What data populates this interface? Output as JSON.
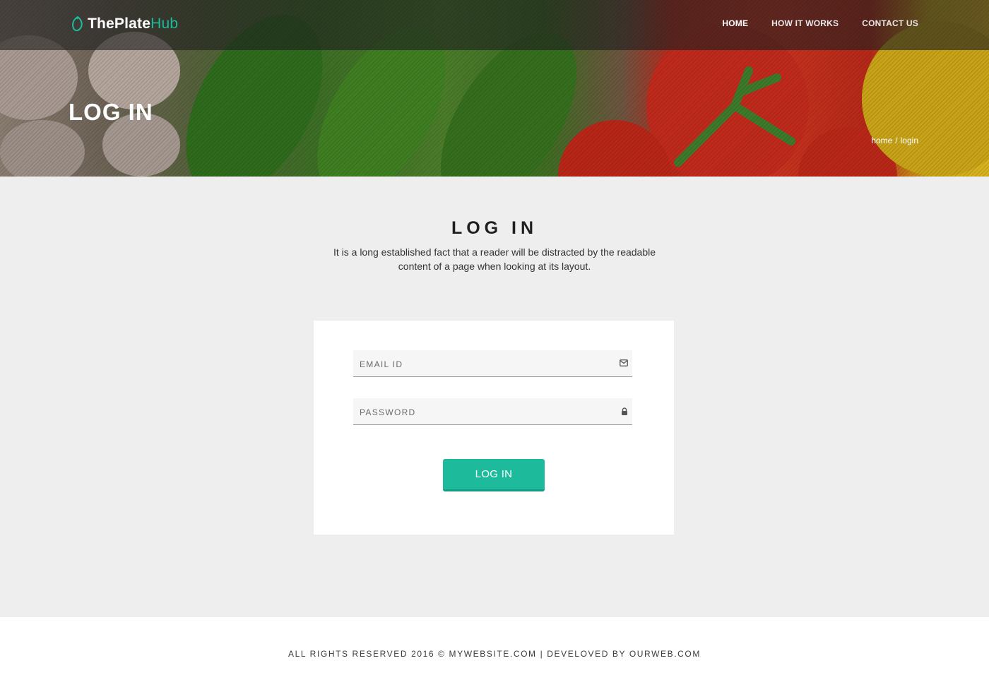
{
  "brand": {
    "name_part1": "ThePlate",
    "name_part2": "Hub",
    "logo_icon": "leaf-icon",
    "accent_color": "#1dbb9b"
  },
  "nav": {
    "items": [
      {
        "label": "HOME",
        "active": true
      },
      {
        "label": "HOW IT WORKS",
        "active": false
      },
      {
        "label": "CONTACT US",
        "active": false
      }
    ]
  },
  "hero": {
    "title": "LOG IN",
    "breadcrumb": {
      "home": "home",
      "separator": "/",
      "current": "login"
    }
  },
  "section": {
    "title": "LOG IN",
    "description": "It is a long established fact that a reader will be distracted by the readable content of a page when looking at its layout."
  },
  "form": {
    "email": {
      "placeholder": "EMAIL ID",
      "value": "",
      "icon": "envelope-icon"
    },
    "password": {
      "placeholder": "PASSWORD",
      "value": "",
      "icon": "lock-icon"
    },
    "submit_label": "LOG IN"
  },
  "footer": {
    "text": "ALL RIGHTS RESERVED 2016 © MYWEBSITE.COM | DEVELOVED BY OURWEB.COM"
  }
}
